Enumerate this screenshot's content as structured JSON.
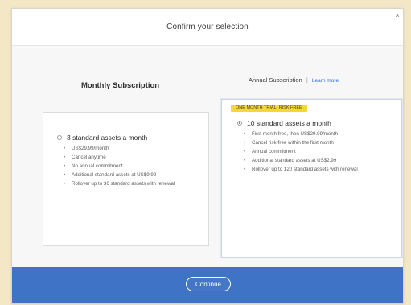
{
  "dialog": {
    "title": "Confirm your selection",
    "close_icon": "close-icon"
  },
  "monthly": {
    "heading": "Monthly Subscription",
    "option_label": "3 standard assets a month",
    "selected": false,
    "features": [
      "US$29.99/month",
      "Cancel anytime",
      "No annual commitment",
      "Additional standard assets at US$9.99",
      "Rollover up to 36 standard assets with renewal"
    ]
  },
  "annual": {
    "heading": "Annual Subscription",
    "learn_more": "Learn more",
    "badge": "ONE MONTH TRIAL, RISK FREE",
    "option_label": "10 standard assets a month",
    "selected": true,
    "features": [
      "First month free, then US$29.99/month",
      "Cancel risk-free within the first month",
      "Annual commitment",
      "Additional standard assets at US$2.99",
      "Rollover up to 120 standard assets with renewal"
    ]
  },
  "footer": {
    "continue_label": "Continue"
  },
  "colors": {
    "background": "#f3e7c6",
    "footer": "#3e73c6",
    "badge": "#f4d936",
    "link": "#2d6ce0"
  }
}
